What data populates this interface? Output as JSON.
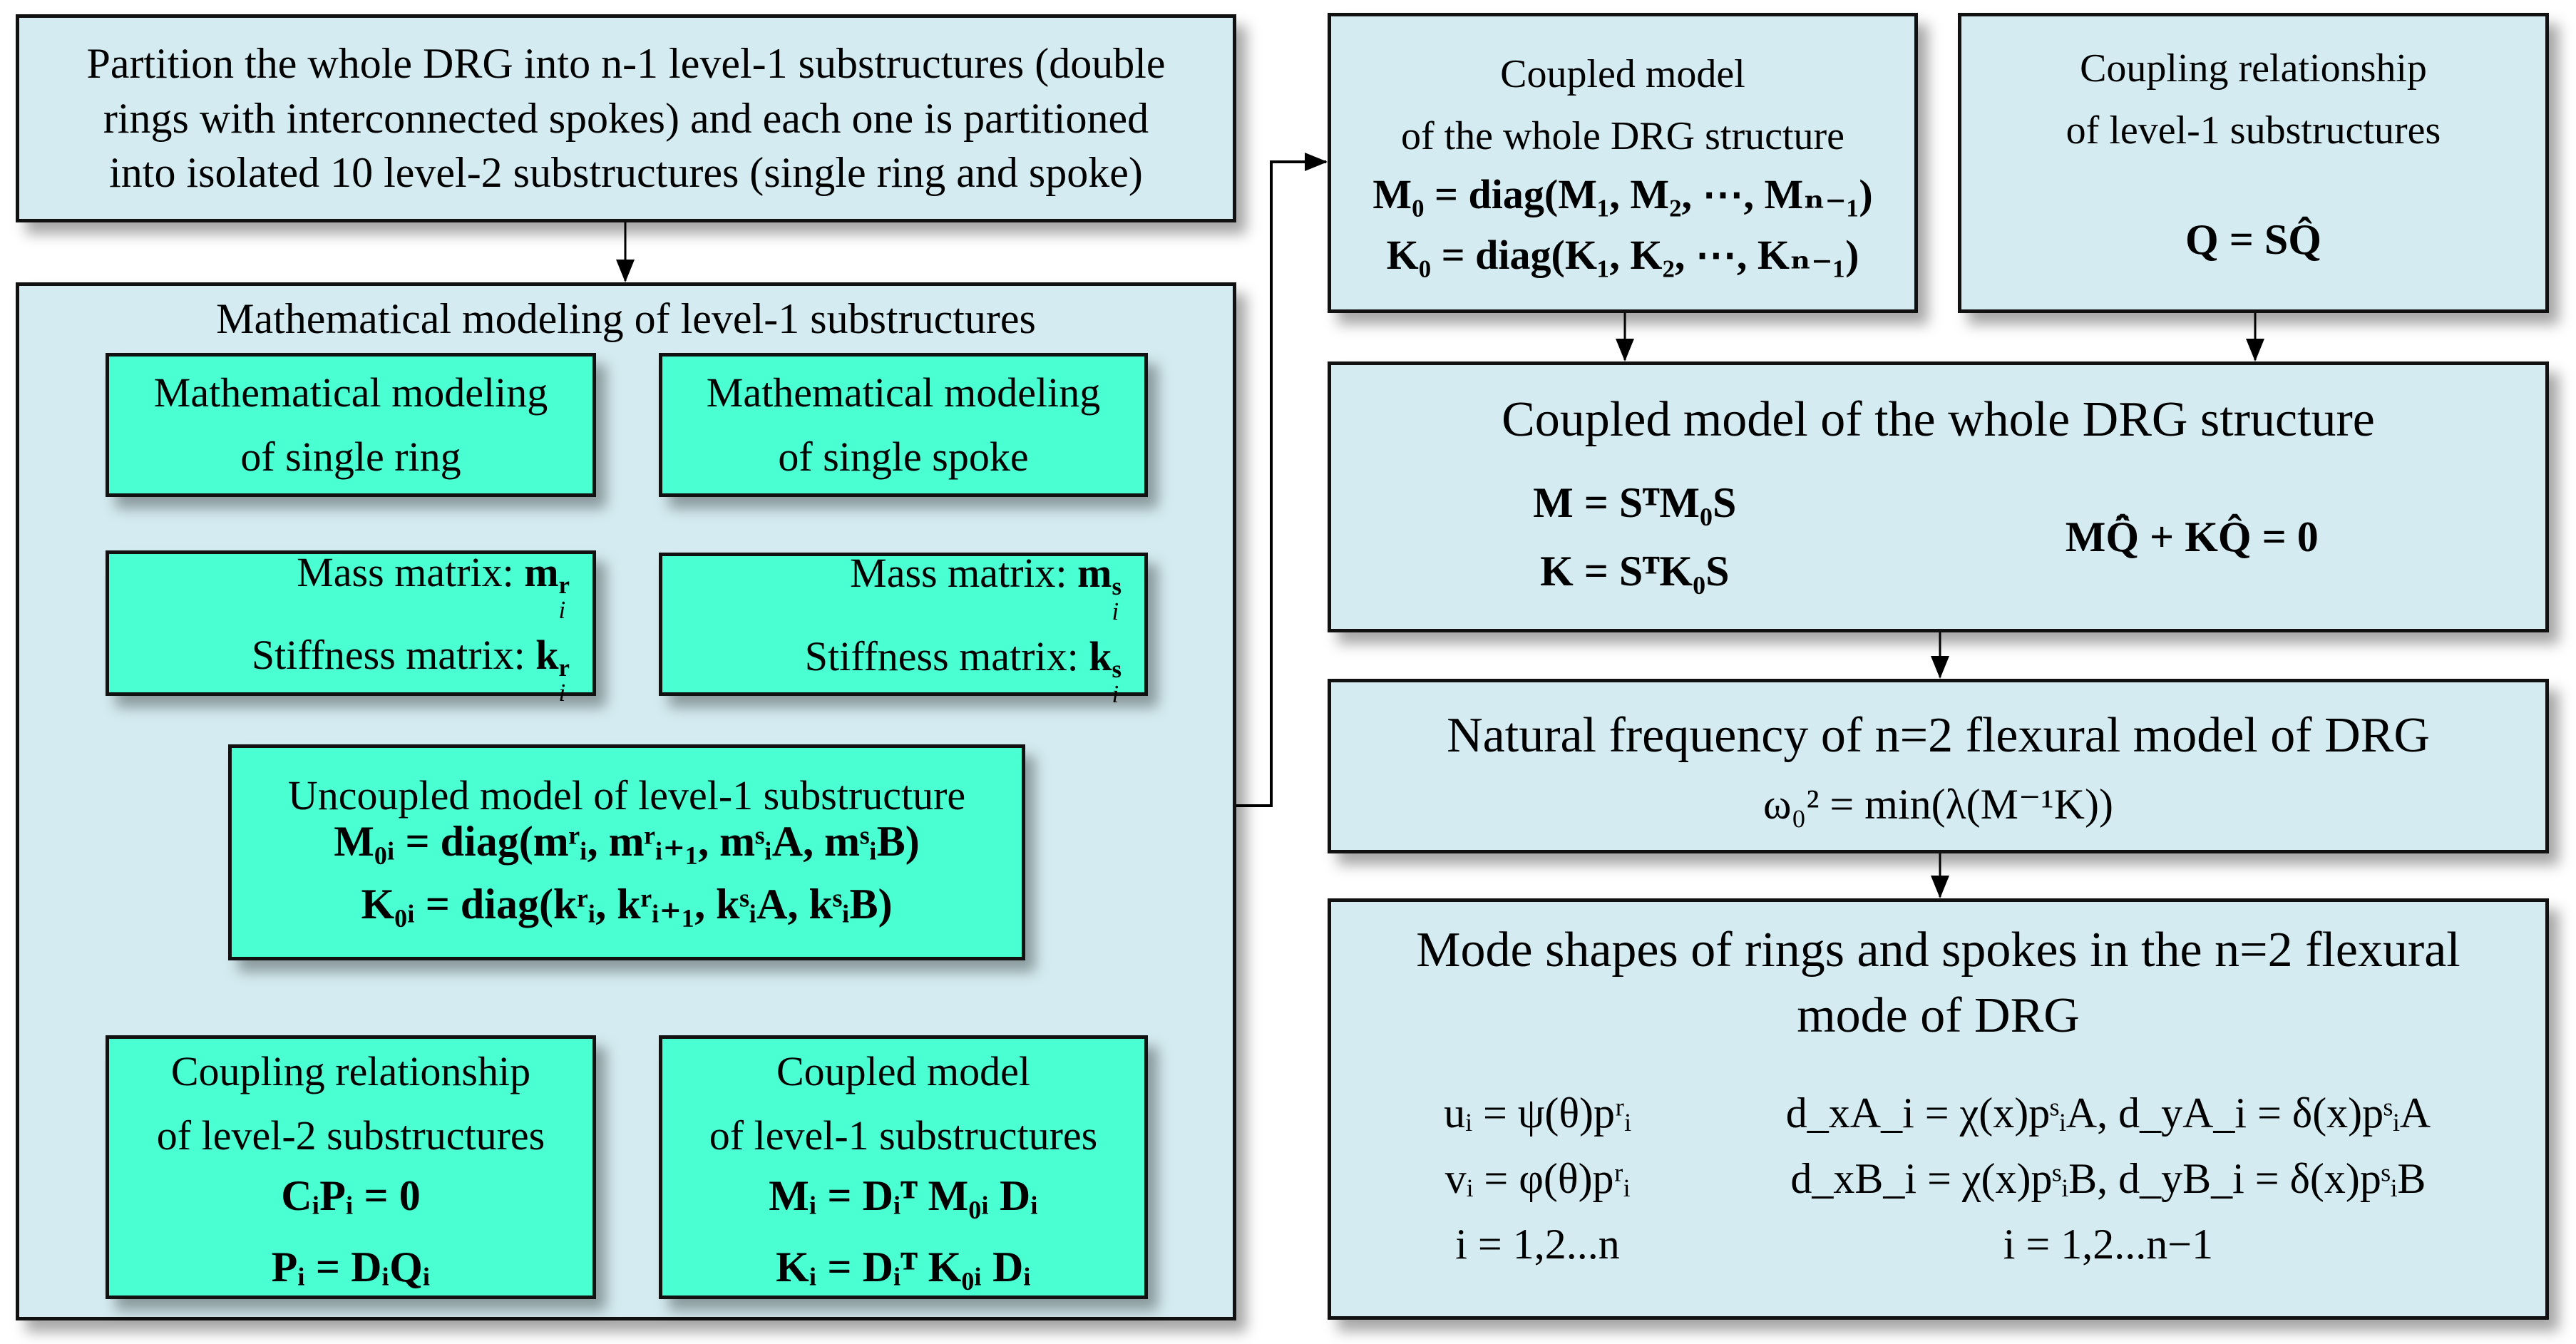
{
  "top_box": {
    "lines": [
      "Partition the whole DRG into n-1 level-1 substructures (double",
      "rings with interconnected spokes) and each one is partitioned",
      "into isolated 10 level-2 substructures (single ring and spoke)"
    ]
  },
  "level1_group": {
    "title": "Mathematical modeling of level-1 substructures",
    "ring_box": {
      "lines": [
        "Mathematical modeling",
        "of single ring"
      ]
    },
    "spoke_box": {
      "lines": [
        "Mathematical modeling",
        "of single spoke"
      ]
    },
    "ring_matrices": {
      "mass_label": "Mass matrix:",
      "mass_symbol": "m",
      "mass_sup": "r",
      "mass_sub": "i",
      "stiff_label": "Stiffness matrix:",
      "stiff_symbol": "k",
      "stiff_sup": "r",
      "stiff_sub": "i"
    },
    "spoke_matrices": {
      "mass_label": "Mass matrix:",
      "mass_symbol": "m",
      "mass_sup": "s",
      "mass_sub": "i",
      "stiff_label": "Stiffness matrix:",
      "stiff_symbol": "k",
      "stiff_sup": "s",
      "stiff_sub": "i"
    },
    "uncoupled_box": {
      "title": "Uncoupled model of level-1 substructure",
      "eq_M": "M₀ᵢ = diag(mʳᵢ, mʳᵢ₊₁, mˢᵢA, mˢᵢB)",
      "eq_K": "K₀ᵢ = diag(kʳᵢ, kʳᵢ₊₁, kˢᵢA, kˢᵢB)"
    },
    "coupling_l2_box": {
      "lines": [
        "Coupling relationship",
        "of level-2 substructures"
      ],
      "eq1": "CᵢPᵢ = 0",
      "eq2": "Pᵢ = DᵢQᵢ"
    },
    "coupled_l1_box": {
      "lines": [
        "Coupled model",
        "of level-1 substructures"
      ],
      "eq1": "Mᵢ = Dᵢᵀ M₀ᵢ Dᵢ",
      "eq2": "Kᵢ = Dᵢᵀ K₀ᵢ Dᵢ"
    }
  },
  "right": {
    "coupled_whole_top": {
      "lines": [
        "Coupled model",
        "of the whole DRG structure"
      ],
      "eq1": "M₀ = diag(M₁, M₂, ⋯, Mₙ₋₁)",
      "eq2": "K₀ = diag(K₁, K₂, ⋯, Kₙ₋₁)"
    },
    "coupling_l1": {
      "lines": [
        "Coupling relationship",
        "of level-1 substructures"
      ],
      "eq": "Q = SQ̂"
    },
    "coupled_whole": {
      "title": "Coupled model of the whole DRG structure",
      "eq_M": "M = SᵀM₀S",
      "eq_K": "K = SᵀK₀S",
      "eq_motion": "MQ̂̈ + KQ̂ = 0"
    },
    "natural_freq": {
      "title": "Natural frequency of n=2 flexural model of DRG",
      "eq": "ω₀² = min(λ(M⁻¹K))"
    },
    "mode_shapes": {
      "title_lines": [
        "Mode shapes of rings and spokes in the n=2 flexural",
        "mode of DRG"
      ],
      "left_eqs": [
        "uᵢ = ψ(θ)pʳᵢ",
        "vᵢ = φ(θ)pʳᵢ",
        "i = 1,2...n"
      ],
      "right_eqs": [
        "d_xA_i = χ(x)pˢᵢA, d_yA_i = δ(x)pˢᵢA",
        "d_xB_i = χ(x)pˢᵢB, d_yB_i = δ(x)pˢᵢB",
        "i = 1,2...n−1"
      ]
    }
  },
  "colors": {
    "light_blue": "#d4ecf1",
    "teal": "#4affd2",
    "border": "#111111"
  }
}
